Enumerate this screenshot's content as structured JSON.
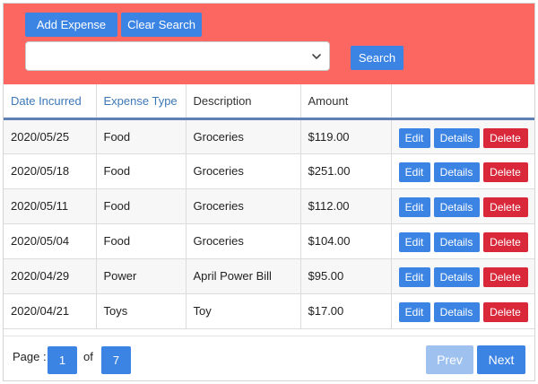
{
  "toolbar": {
    "add_label": "Add Expense",
    "clear_label": "Clear Search",
    "search_label": "Search",
    "select_value": ""
  },
  "table": {
    "headers": [
      "Date Incurred",
      "Expense Type",
      "Description",
      "Amount",
      ""
    ],
    "rows": [
      {
        "date": "2020/05/25",
        "type": "Food",
        "description": "Groceries",
        "amount": "$119.00"
      },
      {
        "date": "2020/05/18",
        "type": "Food",
        "description": "Groceries",
        "amount": "$251.00"
      },
      {
        "date": "2020/05/11",
        "type": "Food",
        "description": "Groceries",
        "amount": "$112.00"
      },
      {
        "date": "2020/05/04",
        "type": "Food",
        "description": "Groceries",
        "amount": "$104.00"
      },
      {
        "date": "2020/04/29",
        "type": "Power",
        "description": "April Power Bill",
        "amount": "$95.00"
      },
      {
        "date": "2020/04/21",
        "type": "Toys",
        "description": "Toy",
        "amount": "$17.00"
      }
    ],
    "row_actions": {
      "edit": "Edit",
      "details": "Details",
      "delete": "Delete"
    }
  },
  "pager": {
    "page_label": "Page :",
    "current_page": "1",
    "of_label": "of",
    "total_pages": "7",
    "prev_label": "Prev",
    "next_label": "Next"
  },
  "colors": {
    "header_panel": "#fc6761",
    "primary_button": "#3b84e4",
    "danger_button": "#d8283a",
    "disabled_button": "#9fc1ef",
    "sortable_header_text": "#3c78b8"
  },
  "icons": {
    "select_caret": "chevron-down-icon"
  }
}
